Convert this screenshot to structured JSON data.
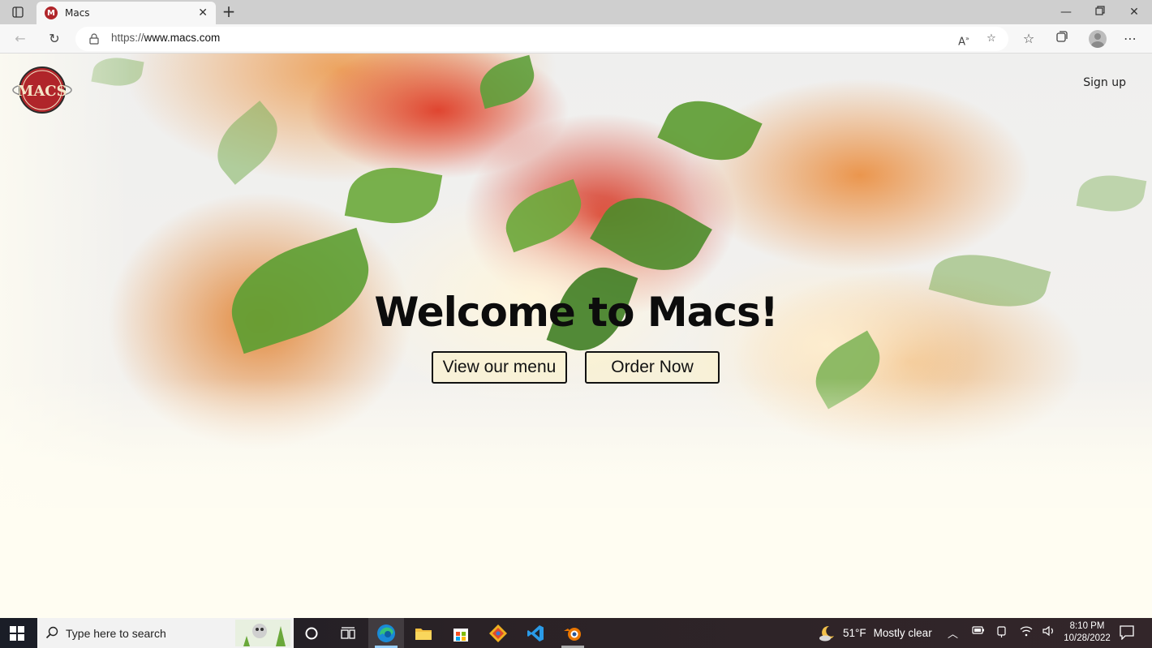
{
  "browser": {
    "tab_title": "Macs",
    "favicon_letter": "M",
    "address": {
      "scheme": "https://",
      "host": "www.macs.com"
    }
  },
  "page": {
    "logo_text": "MACS",
    "signup_label": "Sign up",
    "heading": "Welcome to Macs!",
    "buttons": {
      "menu": "View our menu",
      "order": "Order Now"
    },
    "colors": {
      "background": "#fffdf2",
      "logo_red": "#b0252a"
    }
  },
  "taskbar": {
    "search_placeholder": "Type here to search",
    "weather": {
      "temp": "51°F",
      "condition": "Mostly clear"
    },
    "clock": {
      "time": "8:10 PM",
      "date": "10/28/2022"
    }
  }
}
